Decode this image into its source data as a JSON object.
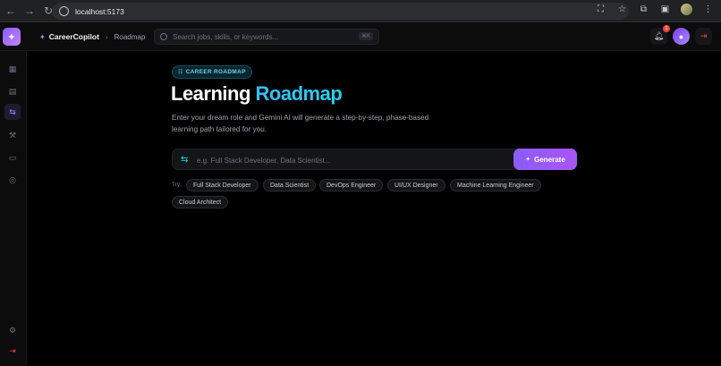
{
  "browser": {
    "url": "localhost:5173"
  },
  "app": {
    "brand_name": "CareerCopilot",
    "breadcrumb": "Roadmap",
    "search_placeholder": "Search jobs, skills, or keywords...",
    "search_shortcut": "⌘K",
    "notification_count": "1"
  },
  "main": {
    "badge": "CAREER ROADMAP",
    "title_part1": "Learning ",
    "title_part2": "Roadmap",
    "subtitle": "Enter your dream role and Gemini AI will generate a step-by-step, phase-based learning path tailored for you.",
    "input_placeholder": "e.g. Full Stack Developer, Data Scientist...",
    "generate_label": "Generate",
    "try_label": "Try:",
    "suggestions": [
      "Full Stack Developer",
      "Data Scientist",
      "DevOps Engineer",
      "UI/UX Designer",
      "Machine Learning Engineer",
      "Cloud Architect"
    ]
  },
  "colors": {
    "accent_purple": "#8b5cf6",
    "accent_cyan": "#22d3ee",
    "danger": "#ef4444"
  }
}
